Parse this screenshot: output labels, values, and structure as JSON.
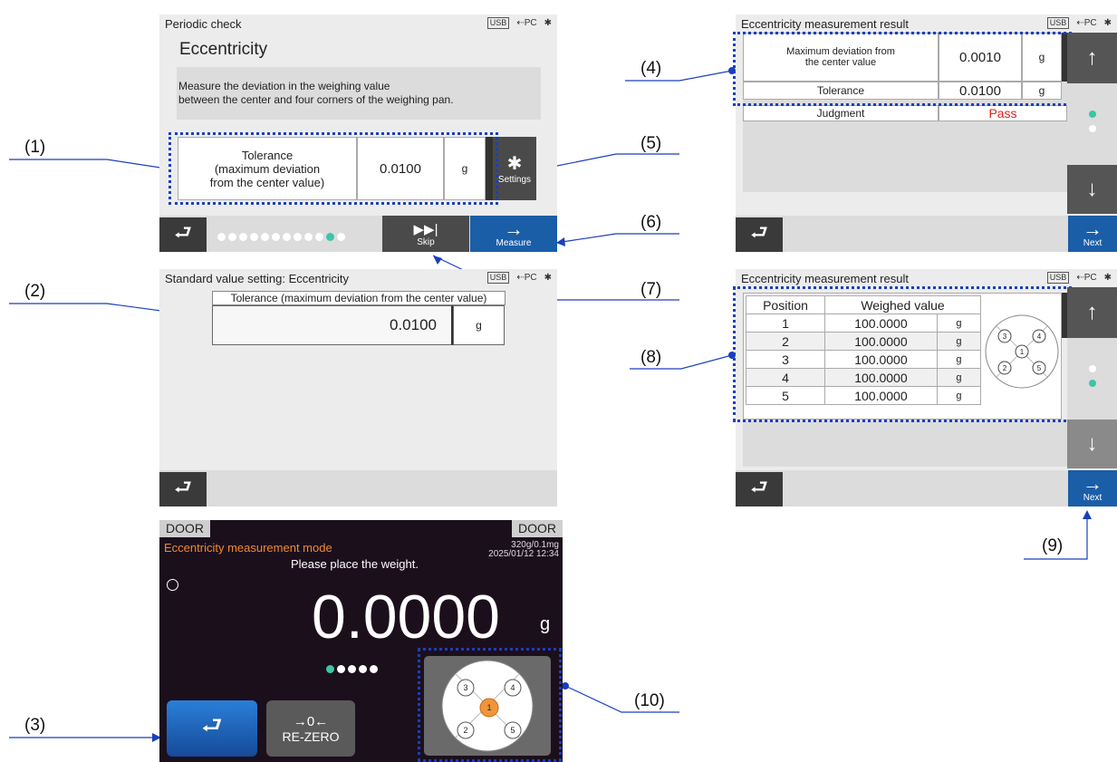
{
  "callouts": [
    "(1)",
    "(2)",
    "(3)",
    "(4)",
    "(5)",
    "(6)",
    "(7)",
    "(8)",
    "(9)",
    "(10)"
  ],
  "status": {
    "usb": "USB",
    "pc": "PC",
    "bt": "✱"
  },
  "screen1": {
    "title": "Periodic check",
    "heading": "Eccentricity",
    "desc_line1": "Measure the deviation in the weighing value",
    "desc_line2": "between the center and four corners of the weighing pan.",
    "tol_label_1": "Tolerance",
    "tol_label_2": "(maximum deviation",
    "tol_label_3": "from the center value)",
    "tol_value": "0.0100",
    "tol_unit": "g",
    "settings_label": "Settings",
    "skip_label": "Skip",
    "measure_label": "Measure"
  },
  "screen2": {
    "title": "Standard value setting: Eccentricity",
    "field_label": "Tolerance (maximum deviation from the center value)",
    "field_value": "0.0100",
    "unit": "g"
  },
  "screen3": {
    "door_left": "DOOR",
    "door_right": "DOOR",
    "mode": "Eccentricity measurement mode",
    "capacity": "320g/0.1mg",
    "datetime": "2025/01/12  12:34",
    "prompt": "Please place the weight.",
    "reading": "0.0000",
    "unit": "g",
    "rezero_symbol": "→0←",
    "rezero_label": "RE-ZERO",
    "positions": [
      "1",
      "2",
      "3",
      "4",
      "5"
    ]
  },
  "screen4": {
    "title": "Eccentricity measurement result",
    "row1_label_1": "Maximum deviation from",
    "row1_label_2": "the center value",
    "row1_value": "0.0010",
    "row1_unit": "g",
    "row2_label": "Tolerance",
    "row2_value": "0.0100",
    "row2_unit": "g",
    "row3_label": "Judgment",
    "row3_value": "Pass",
    "next_label": "Next"
  },
  "screen5": {
    "title": "Eccentricity measurement result",
    "col_position": "Position",
    "col_weighed": "Weighed value",
    "rows": [
      {
        "pos": "1",
        "value": "100.0000",
        "unit": "g"
      },
      {
        "pos": "2",
        "value": "100.0000",
        "unit": "g"
      },
      {
        "pos": "3",
        "value": "100.0000",
        "unit": "g"
      },
      {
        "pos": "4",
        "value": "100.0000",
        "unit": "g"
      },
      {
        "pos": "5",
        "value": "100.0000",
        "unit": "g"
      }
    ],
    "next_label": "Next"
  },
  "colors": {
    "blue_button": "#1a5ea8",
    "pass_red": "#e02020",
    "mode_orange": "#f08a30",
    "dotted": "#1a3fbf",
    "dot_active": "#3cc5a8"
  }
}
